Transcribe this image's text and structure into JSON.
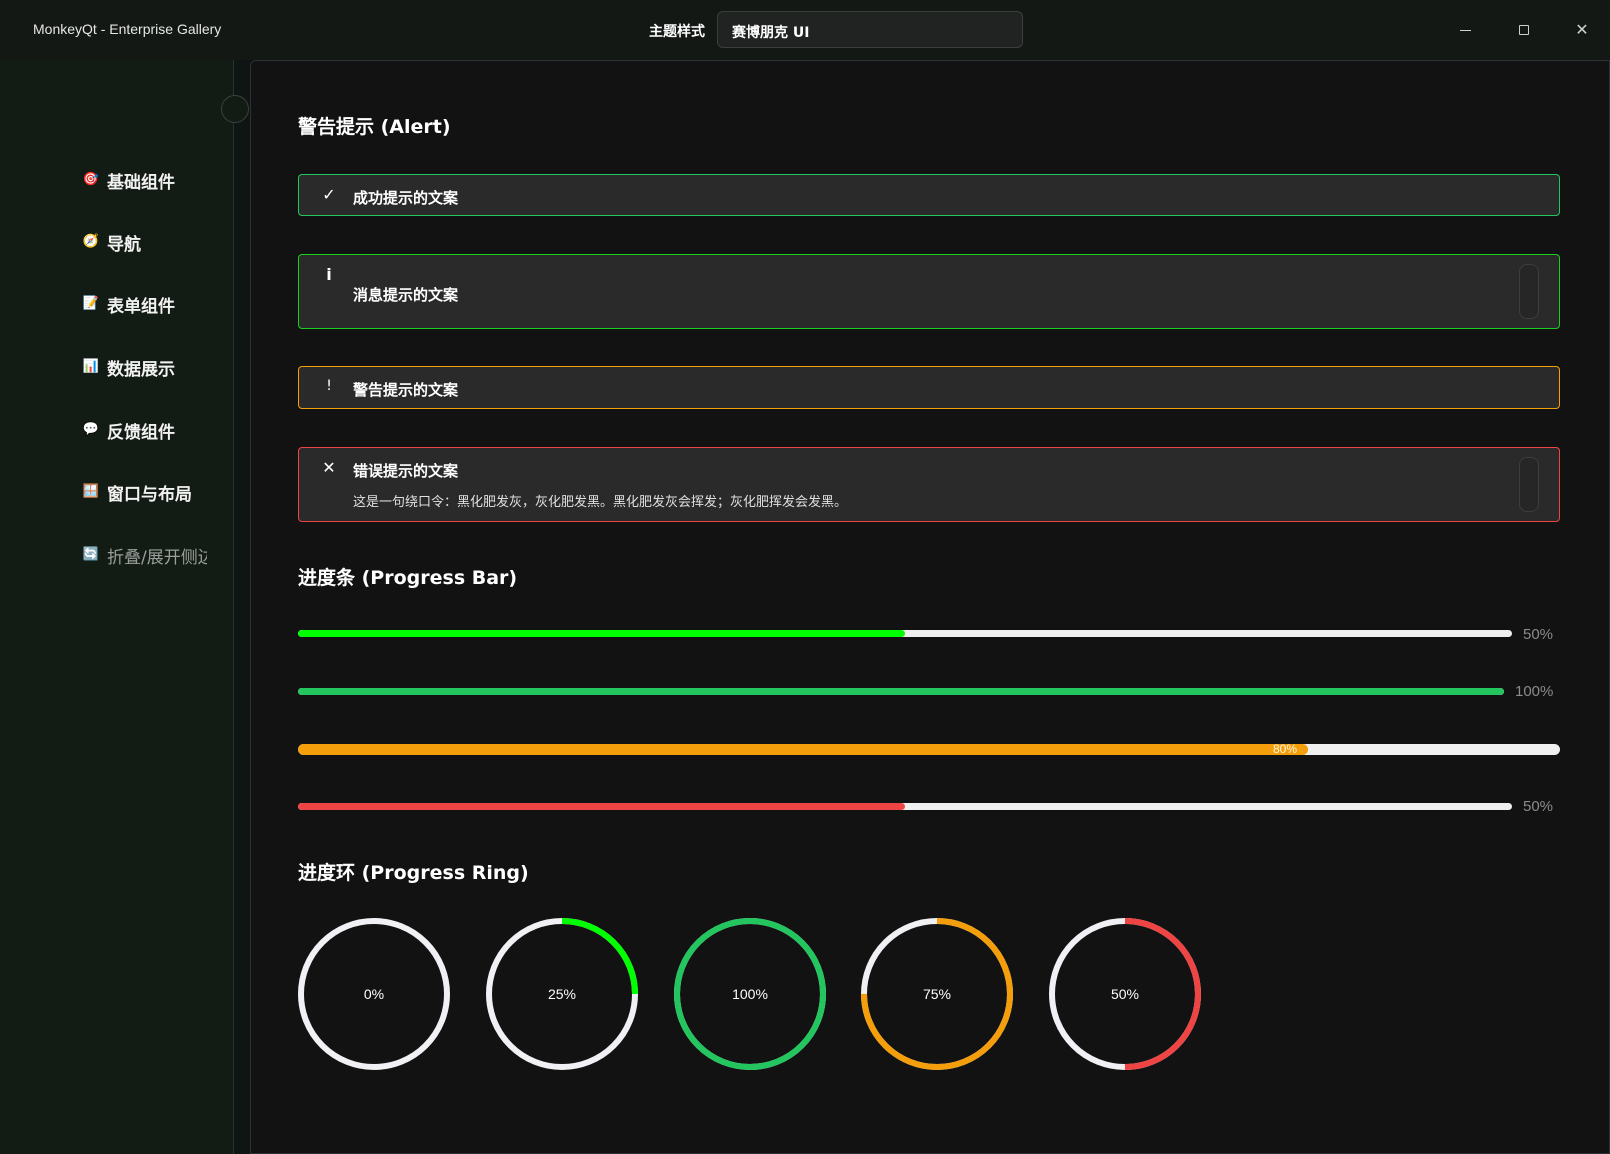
{
  "window": {
    "title": "MonkeyQt - Enterprise Gallery",
    "theme_label": "主题样式",
    "theme_value": "赛博朋克 UI",
    "controls": {
      "minimize": "minimize-icon",
      "maximize": "maximize-icon",
      "close": "✕"
    }
  },
  "sidebar": {
    "items": [
      {
        "icon": "🎯",
        "label": "基础组件"
      },
      {
        "icon": "🧭",
        "label": "导航"
      },
      {
        "icon": "📝",
        "label": "表单组件"
      },
      {
        "icon": "📊",
        "label": "数据展示"
      },
      {
        "icon": "💬",
        "label": "反馈组件"
      },
      {
        "icon": "🪟",
        "label": "窗口与布局"
      },
      {
        "icon": "🔄",
        "label": "折叠/展开侧边栏"
      }
    ]
  },
  "alerts": {
    "title": "警告提示 (Alert)",
    "items": [
      {
        "type": "success",
        "icon": "✓",
        "title": "成功提示的文案",
        "color": "#22c55e"
      },
      {
        "type": "info",
        "icon": "i",
        "title": "消息提示的文案",
        "color": "#19d11d"
      },
      {
        "type": "warning",
        "icon": "!",
        "title": "警告提示的文案",
        "color": "#f59e0b"
      },
      {
        "type": "error",
        "icon": "✕",
        "title": "错误提示的文案",
        "description": "这是一句绕口令：黑化肥发灰，灰化肥发黑。黑化肥发灰会挥发；灰化肥挥发会发黑。",
        "color": "#ef4444"
      }
    ]
  },
  "progress_bars": {
    "title": "进度条 (Progress Bar)",
    "items": [
      {
        "value": 0.5,
        "text": "50%",
        "color": "#00ff00"
      },
      {
        "value": 1.0,
        "text": "100%",
        "color": "#22c55e"
      },
      {
        "value": 0.8,
        "text": "80%",
        "color": "#f59e0b",
        "inside": true
      },
      {
        "value": 0.5,
        "text": "50%",
        "color": "#ef4444"
      }
    ]
  },
  "progress_rings": {
    "title": "进度环 (Progress Ring)",
    "items": [
      {
        "value": 0,
        "text": "0%",
        "color": "#f0f0f5"
      },
      {
        "value": 0.25,
        "text": "25%",
        "color": "#00ff00"
      },
      {
        "value": 1.0,
        "text": "100%",
        "color": "#22c55e"
      },
      {
        "value": 0.75,
        "text": "75%",
        "color": "#f59e0b"
      },
      {
        "value": 0.5,
        "text": "50%",
        "color": "#ef4444"
      }
    ],
    "track_color": "#f0f0f5"
  }
}
